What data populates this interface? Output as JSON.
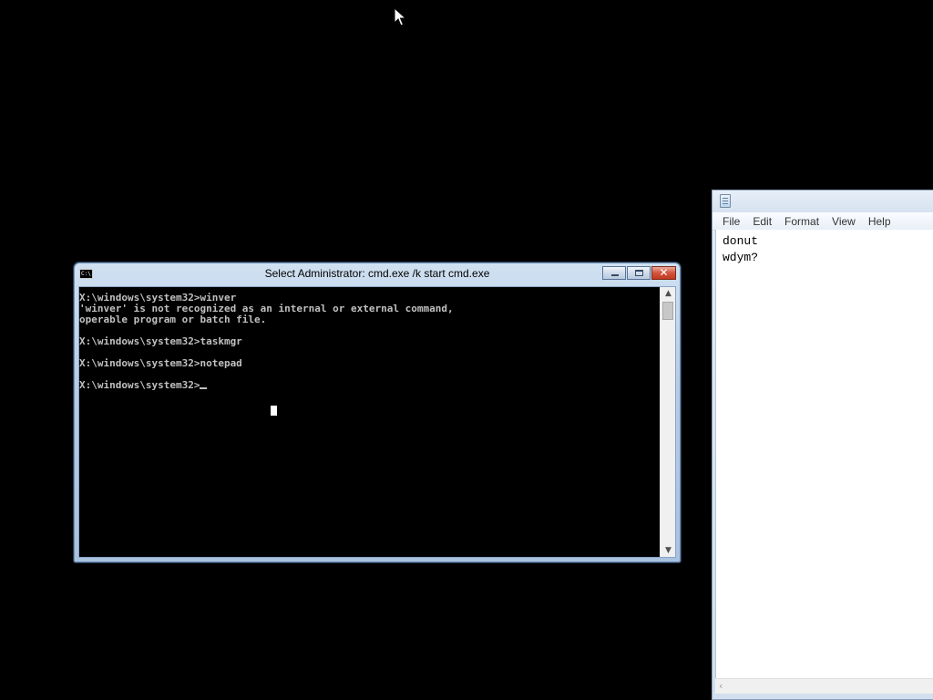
{
  "cmd": {
    "title": "Select Administrator: cmd.exe /k start cmd.exe",
    "system_icon_text": "C:\\",
    "lines": [
      "X:\\windows\\system32>winver",
      "'winver' is not recognized as an internal or external command,",
      "operable program or batch file.",
      "",
      "X:\\windows\\system32>taskmgr",
      "",
      "X:\\windows\\system32>notepad",
      "",
      "X:\\windows\\system32>"
    ],
    "scroll_up_glyph": "▲",
    "scroll_down_glyph": "▼",
    "minimize_icon": "minimize-icon",
    "maximize_icon": "maximize-icon",
    "close_glyph": "✕"
  },
  "notepad": {
    "menu": [
      "File",
      "Edit",
      "Format",
      "View",
      "Help"
    ],
    "content": "donut\nwdym?",
    "hscroll_left_glyph": "‹"
  },
  "colors": {
    "desktop": "#000000",
    "console_text": "#c0c0c0",
    "console_bg": "#000000",
    "close_button": "#c23a1f"
  }
}
